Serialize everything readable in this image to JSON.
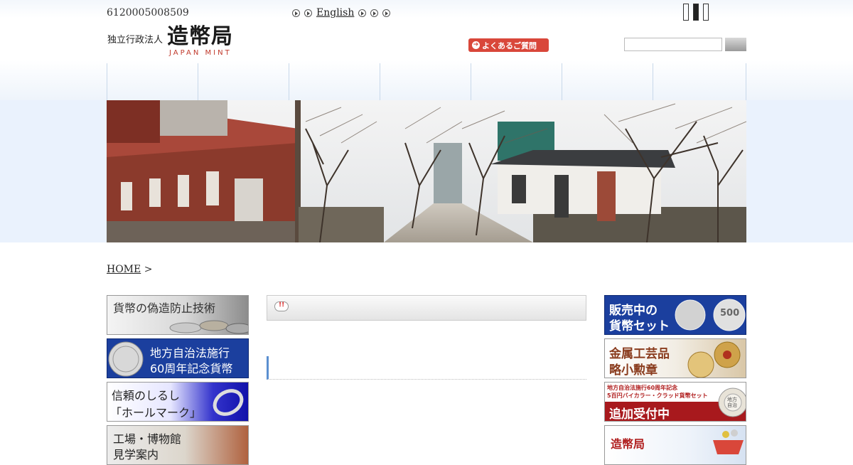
{
  "header": {
    "corporate_number": "6120005008509",
    "english_link": "English",
    "faq_label": "よくあるご質問",
    "logo": {
      "prefix": "独立行政法人",
      "name": "造幣局",
      "english": "JAPAN MINT"
    },
    "search": {
      "value": "",
      "placeholder": ""
    }
  },
  "breadcrumb": {
    "home": "HOME",
    "separator": ">"
  },
  "left_banners": [
    {
      "label": "貨幣の偽造防止技術"
    },
    {
      "label_line1": "地方自治法施行",
      "label_line2": "60周年記念貨幣"
    },
    {
      "label_line1": "信頼のしるし",
      "label_line2": "「ホールマーク」"
    },
    {
      "label_line1": "工場・博物館",
      "label_line2": "見学案内"
    }
  ],
  "right_banners": [
    {
      "label_line1": "販売中の",
      "label_line2": "貨幣セット",
      "coin_left": "",
      "coin_right": "500"
    },
    {
      "label_line1": "金属工芸品",
      "label_line2": "略小勲章"
    },
    {
      "label_line1": "地方自治法施行60周年記念",
      "label_line2": "5百円バイカラー・クラッド貨幣セット",
      "label_line3": "追加受付中",
      "coin": "地方自治"
    },
    {
      "label_line1": "造幣局"
    }
  ],
  "colors": {
    "accent_red": "#d9473a",
    "banner_blue": "#1b3f9e",
    "nav_border": "#c8d8ea",
    "content_rule": "#5b8fd0"
  }
}
